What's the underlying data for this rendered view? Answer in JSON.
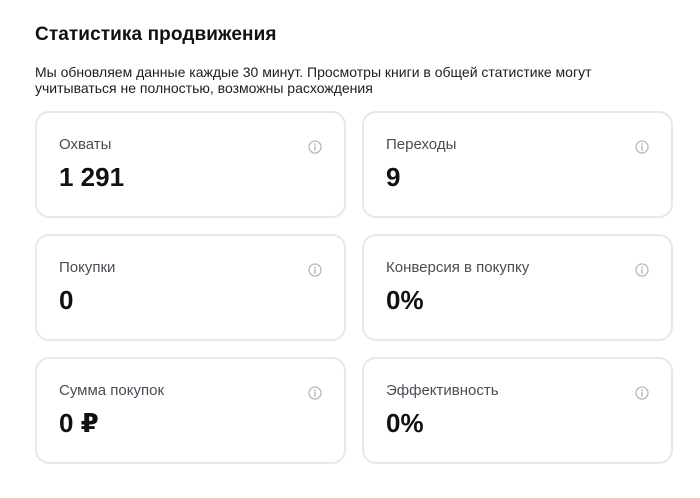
{
  "header": {
    "title": "Статистика продвижения",
    "description": "Мы обновляем данные каждые 30 минут. Просмотры книги в общей статистике могут учитываться не полностью, возможны расхождения"
  },
  "cards": [
    {
      "label": "Охваты",
      "value": "1 291",
      "icon": "info-icon"
    },
    {
      "label": "Переходы",
      "value": "9",
      "icon": "info-icon"
    },
    {
      "label": "Покупки",
      "value": "0",
      "icon": "info-icon"
    },
    {
      "label": "Конверсия в покупку",
      "value": "0%",
      "icon": "info-icon"
    },
    {
      "label": "Сумма покупок",
      "value": "0 ₽",
      "icon": "info-icon"
    },
    {
      "label": "Эффективность",
      "value": "0%",
      "icon": "info-icon"
    }
  ],
  "colors": {
    "card_border": "#e6e8ec",
    "label": "#4a4d55",
    "value": "#111111",
    "icon": "#b5b8bf"
  }
}
